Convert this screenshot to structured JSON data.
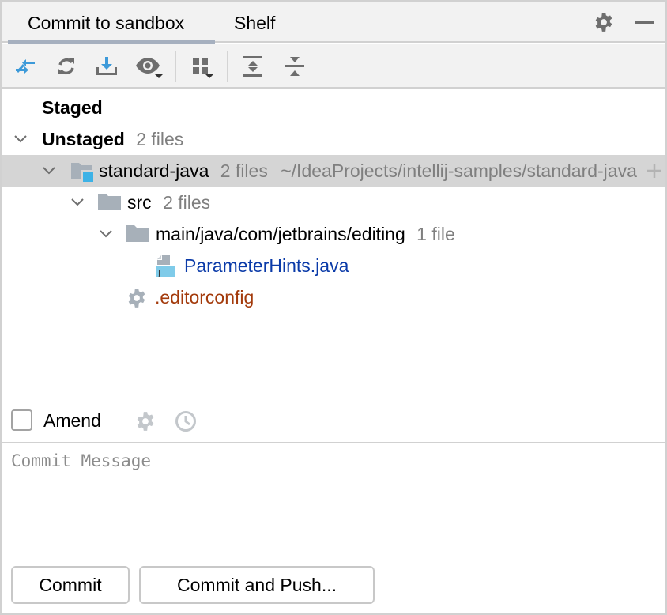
{
  "tabs": [
    {
      "label": "Commit to sandbox",
      "active": true
    },
    {
      "label": "Shelf",
      "active": false
    }
  ],
  "header_icons": [
    "gear-icon",
    "minimize-icon"
  ],
  "toolbar": {
    "buttons": [
      {
        "name": "rollback-icon",
        "tooltip": "Rollback"
      },
      {
        "name": "refresh-icon",
        "tooltip": "Refresh"
      },
      {
        "name": "update-icon",
        "tooltip": "Update"
      },
      {
        "name": "view-options-icon",
        "tooltip": "View Options"
      },
      {
        "name": "group-by-icon",
        "tooltip": "Group By"
      },
      {
        "name": "expand-all-icon",
        "tooltip": "Expand All"
      },
      {
        "name": "collapse-all-icon",
        "tooltip": "Collapse All"
      }
    ]
  },
  "colors": {
    "accent_blue": "#3d9ad9",
    "modified_file": "#0a3aa8",
    "new_file": "#a33a0b",
    "icon_gray": "#6e6e6e",
    "selection": "#d5d5d5"
  },
  "tree": {
    "staged": {
      "label": "Staged"
    },
    "unstaged": {
      "label": "Unstaged",
      "count": "2 files"
    },
    "module": {
      "label": "standard-java",
      "count": "2 files",
      "path": "~/IdeaProjects/intellij-samples/standard-java"
    },
    "src": {
      "label": "src",
      "count": "2 files"
    },
    "package": {
      "label": "main/java/com/jetbrains/editing",
      "count": "1 file"
    },
    "file_java": {
      "label": "ParameterHints.java"
    },
    "file_config": {
      "label": ".editorconfig"
    }
  },
  "amend": {
    "label": "Amend",
    "checked": false
  },
  "commit_message": {
    "value": "",
    "placeholder": "Commit Message"
  },
  "buttons": {
    "commit": "Commit",
    "commit_and_push": "Commit and Push..."
  }
}
